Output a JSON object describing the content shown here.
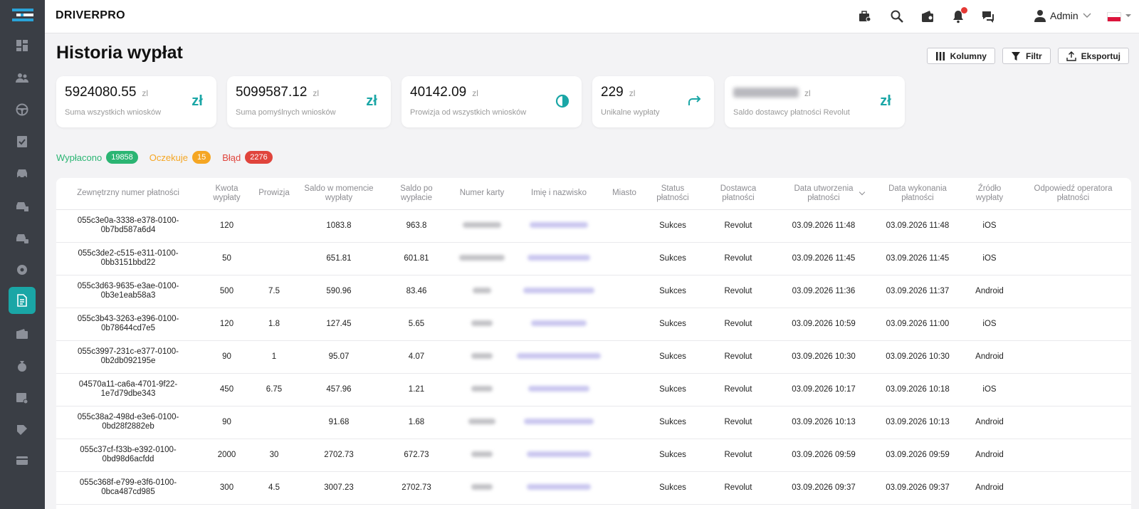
{
  "header": {
    "brand": "DRIVERPRO",
    "user": "Admin"
  },
  "page": {
    "title": "Historia wypłat",
    "actions": {
      "columns": "Kolumny",
      "filter": "Filtr",
      "export": "Eksportuj"
    }
  },
  "cards": [
    {
      "value": "5924080.55",
      "currency": "zl",
      "label": "Suma wszystkich wniosków",
      "icon": "zloty-icon"
    },
    {
      "value": "5099587.12",
      "currency": "zl",
      "label": "Suma pomyślnych wniosków",
      "icon": "zloty-icon"
    },
    {
      "value": "40142.09",
      "currency": "zl",
      "label": "Prowizja od wszystkich wniosków",
      "icon": "coin-icon"
    },
    {
      "value": "229",
      "currency": "zl",
      "label": "Unikalne wypłaty",
      "icon": "share-arrow-icon"
    },
    {
      "value": "",
      "currency": "zl",
      "label": "Saldo dostawcy płatności Revolut",
      "icon": "zloty-icon"
    }
  ],
  "statuses": [
    {
      "label": "Wypłacono",
      "count": "19858"
    },
    {
      "label": "Oczekuje",
      "count": "15"
    },
    {
      "label": "Błąd",
      "count": "2276"
    }
  ],
  "table": {
    "columns": [
      "Zewnętrzny numer płatności",
      "Kwota wypłaty",
      "Prowizja",
      "Saldo w momencie wypłaty",
      "Saldo po wypłacie",
      "Numer karty",
      "Imię i nazwisko",
      "Miasto",
      "Status płatności",
      "Dostawca płatności",
      "Data utworzenia płatności",
      "Data wykonania płatności",
      "Źródło wypłaty",
      "Odpowiedź operatora płatności"
    ],
    "rows": [
      {
        "id": "055c3e0a-3338-e378-0100-0b7bd587a6d4",
        "amount": "120",
        "fee": "",
        "balance_before": "1083.8",
        "balance_after": "963.8",
        "city": "",
        "status": "Sukces",
        "provider": "Revolut",
        "created": "03.09.2026 11:48",
        "executed": "03.09.2026 11:48",
        "source": "iOS",
        "response": ""
      },
      {
        "id": "055c3de2-c515-e311-0100-0bb3151bbd22",
        "amount": "50",
        "fee": "",
        "balance_before": "651.81",
        "balance_after": "601.81",
        "city": "",
        "status": "Sukces",
        "provider": "Revolut",
        "created": "03.09.2026 11:45",
        "executed": "03.09.2026 11:45",
        "source": "iOS",
        "response": ""
      },
      {
        "id": "055c3d63-9635-e3ae-0100-0b3e1eab58a3",
        "amount": "500",
        "fee": "7.5",
        "balance_before": "590.96",
        "balance_after": "83.46",
        "city": "",
        "status": "Sukces",
        "provider": "Revolut",
        "created": "03.09.2026 11:36",
        "executed": "03.09.2026 11:37",
        "source": "Android",
        "response": ""
      },
      {
        "id": "055c3b43-3263-e396-0100-0b78644cd7e5",
        "amount": "120",
        "fee": "1.8",
        "balance_before": "127.45",
        "balance_after": "5.65",
        "city": "",
        "status": "Sukces",
        "provider": "Revolut",
        "created": "03.09.2026 10:59",
        "executed": "03.09.2026 11:00",
        "source": "iOS",
        "response": ""
      },
      {
        "id": "055c3997-231c-e377-0100-0b2db092195e",
        "amount": "90",
        "fee": "1",
        "balance_before": "95.07",
        "balance_after": "4.07",
        "city": "",
        "status": "Sukces",
        "provider": "Revolut",
        "created": "03.09.2026 10:30",
        "executed": "03.09.2026 10:30",
        "source": "Android",
        "response": ""
      },
      {
        "id": "04570a11-ca6a-4701-9f22-1e7d79dbe343",
        "amount": "450",
        "fee": "6.75",
        "balance_before": "457.96",
        "balance_after": "1.21",
        "city": "",
        "status": "Sukces",
        "provider": "Revolut",
        "created": "03.09.2026 10:17",
        "executed": "03.09.2026 10:18",
        "source": "iOS",
        "response": ""
      },
      {
        "id": "055c38a2-498d-e3e6-0100-0bd28f2882eb",
        "amount": "90",
        "fee": "",
        "balance_before": "91.68",
        "balance_after": "1.68",
        "city": "",
        "status": "Sukces",
        "provider": "Revolut",
        "created": "03.09.2026 10:13",
        "executed": "03.09.2026 10:13",
        "source": "Android",
        "response": ""
      },
      {
        "id": "055c37cf-f33b-e392-0100-0bd98d6acfdd",
        "amount": "2000",
        "fee": "30",
        "balance_before": "2702.73",
        "balance_after": "672.73",
        "city": "",
        "status": "Sukces",
        "provider": "Revolut",
        "created": "03.09.2026 09:59",
        "executed": "03.09.2026 09:59",
        "source": "Android",
        "response": ""
      },
      {
        "id": "055c368f-e799-e3f6-0100-0bca487cd985",
        "amount": "300",
        "fee": "4.5",
        "balance_before": "3007.23",
        "balance_after": "2702.73",
        "city": "",
        "status": "Sukces",
        "provider": "Revolut",
        "created": "03.09.2026 09:37",
        "executed": "03.09.2026 09:37",
        "source": "Android",
        "response": ""
      }
    ]
  },
  "colors": {
    "accent": "#1aa6a6",
    "sidebar": "#3a3e45",
    "success": "#2bb573",
    "pending": "#f5a623",
    "error": "#e0443c"
  }
}
